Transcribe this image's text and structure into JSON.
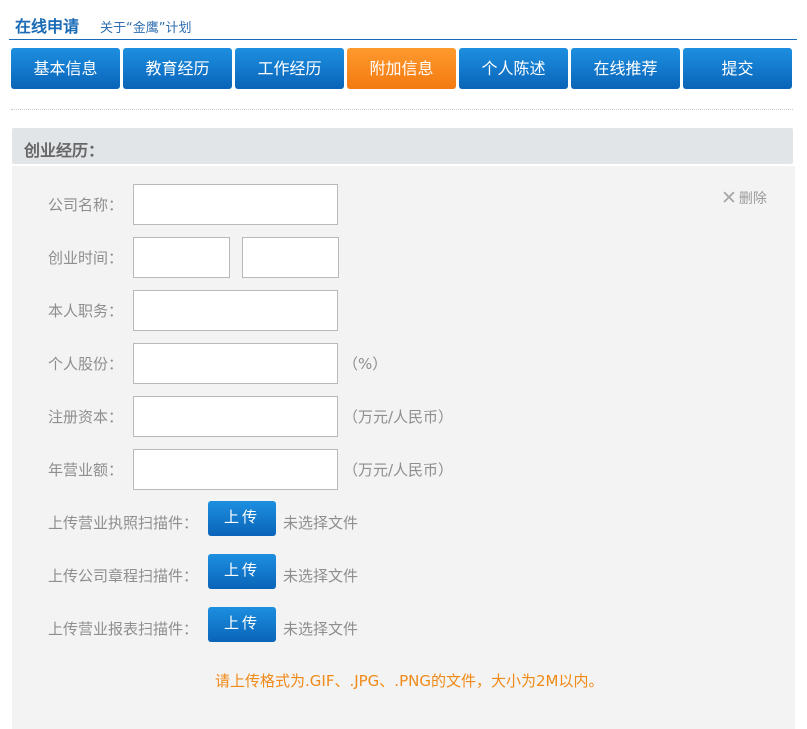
{
  "header": {
    "title": "在线申请",
    "link": "关于“金鹰”计划"
  },
  "tabs": [
    {
      "label": "基本信息",
      "active": false
    },
    {
      "label": "教育经历",
      "active": false
    },
    {
      "label": "工作经历",
      "active": false
    },
    {
      "label": "附加信息",
      "active": true
    },
    {
      "label": "个人陈述",
      "active": false
    },
    {
      "label": "在线推荐",
      "active": false
    },
    {
      "label": "提交",
      "active": false
    }
  ],
  "section": {
    "title": "创业经历：",
    "delete_label": "删除"
  },
  "form": {
    "company_name": {
      "label": "公司名称：",
      "value": ""
    },
    "startup_time": {
      "label": "创业时间：",
      "start": "",
      "end": ""
    },
    "position": {
      "label": "本人职务：",
      "value": ""
    },
    "share": {
      "label": "个人股份：",
      "value": "",
      "unit": "（%）"
    },
    "registered_capital": {
      "label": "注册资本：",
      "value": "",
      "unit": "（万元/人民币）"
    },
    "annual_revenue": {
      "label": "年营业额：",
      "value": "",
      "unit": "（万元/人民币）"
    }
  },
  "uploads": [
    {
      "label": "上传营业执照扫描件：",
      "button": "上传",
      "status": "未选择文件"
    },
    {
      "label": "上传公司章程扫描件：",
      "button": "上传",
      "status": "未选择文件"
    },
    {
      "label": "上传营业报表扫描件：",
      "button": "上传",
      "status": "未选择文件"
    }
  ],
  "note": "请上传格式为.GIF、.JPG、.PNG的文件，大小为2M以内。",
  "colors": {
    "tab_blue": "#0a64b8",
    "tab_active_orange": "#f27a10",
    "note_orange": "#f08a17"
  }
}
